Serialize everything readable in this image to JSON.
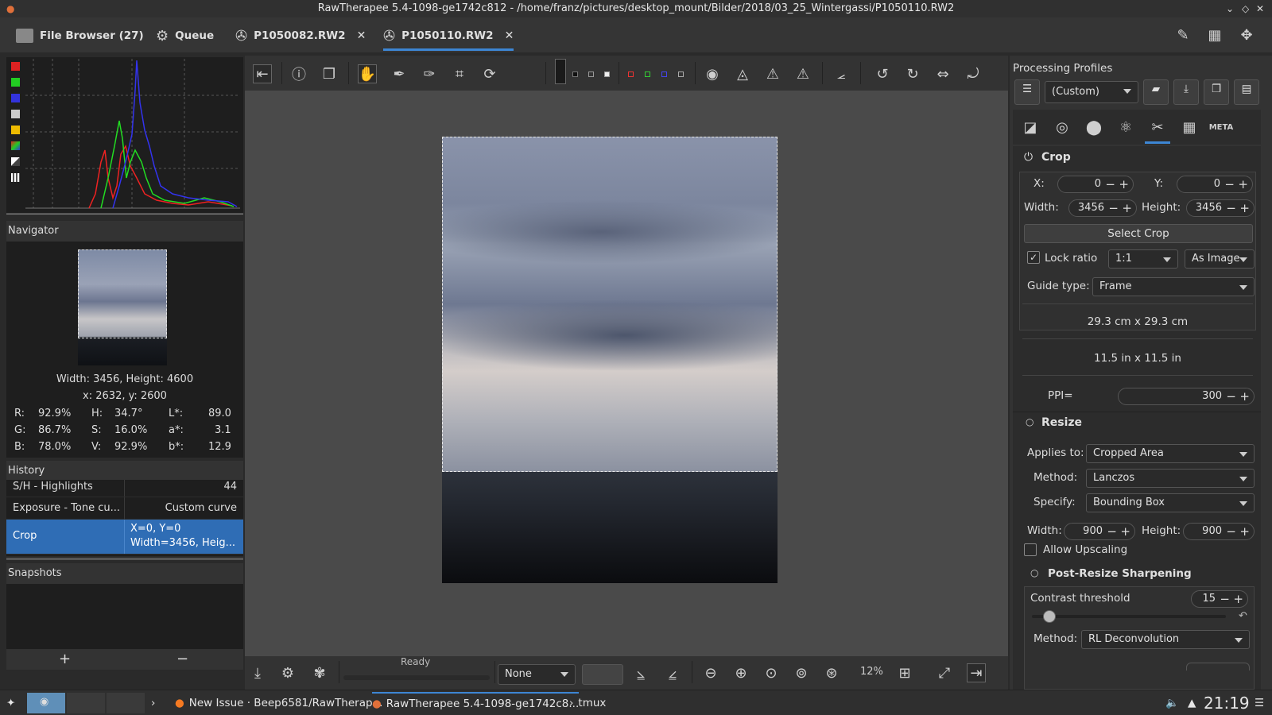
{
  "window": {
    "title": "RawTherapee 5.4-1098-ge1742c812 - /home/franz/pictures/desktop_mount/Bilder/2018/03_25_Wintergassi/P1050110.RW2"
  },
  "tabs": [
    {
      "label": "File Browser (27)",
      "icon": "folder-icon"
    },
    {
      "label": "Queue",
      "icon": "gears-icon"
    },
    {
      "label": "P1050082.RW2",
      "icon": "aperture-icon",
      "closable": true
    },
    {
      "label": "P1050110.RW2",
      "icon": "aperture-icon",
      "closable": true,
      "active": true
    }
  ],
  "navigator": {
    "title": "Navigator",
    "size": "Width: 3456, Height: 4600",
    "coords": "x: 2632, y: 2600",
    "rows": [
      {
        "c1": "R:",
        "v1": "92.9%",
        "c2": "H:",
        "v2": "34.7°",
        "c3": "L*:",
        "v3": "89.0"
      },
      {
        "c1": "G:",
        "v1": "86.7%",
        "c2": "S:",
        "v2": "16.0%",
        "c3": "a*:",
        "v3": "3.1"
      },
      {
        "c1": "B:",
        "v1": "78.0%",
        "c2": "V:",
        "v2": "92.9%",
        "c3": "b*:",
        "v3": "12.9"
      }
    ]
  },
  "history": {
    "title": "History",
    "items": [
      {
        "name": "S/H - Highlights",
        "value": "44"
      },
      {
        "name": "Exposure - Tone cu...",
        "value": "Custom curve"
      },
      {
        "name": "Crop",
        "value": "X=0, Y=0",
        "value2": "Width=3456, Heig...",
        "selected": true
      }
    ]
  },
  "snapshots": {
    "title": "Snapshots",
    "add": "+",
    "remove": "−"
  },
  "bottom": {
    "status": "Ready",
    "combo": "None",
    "zoom": "12%"
  },
  "processing": {
    "title": "Processing Profiles",
    "profile": "(Custom)"
  },
  "crop": {
    "title": "Crop",
    "x_label": "X:",
    "x": "0",
    "y_label": "Y:",
    "y": "0",
    "w_label": "Width:",
    "w": "3456",
    "h_label": "Height:",
    "h": "3456",
    "select_btn": "Select Crop",
    "lock_label": "Lock ratio",
    "ratio": "1:1",
    "orientation": "As Image",
    "guide_label": "Guide type:",
    "guide": "Frame",
    "size_cm": "29.3 cm x 29.3 cm",
    "size_in": "11.5 in x 11.5 in",
    "ppi_label": "PPI=",
    "ppi": "300"
  },
  "resize": {
    "title": "Resize",
    "applies_label": "Applies to:",
    "applies": "Cropped Area",
    "method_label": "Method:",
    "method": "Lanczos",
    "specify_label": "Specify:",
    "specify": "Bounding Box",
    "w_label": "Width:",
    "w": "900",
    "h_label": "Height:",
    "h": "900",
    "upscale_label": "Allow Upscaling"
  },
  "sharpen": {
    "title": "Post-Resize Sharpening",
    "threshold_label": "Contrast threshold",
    "threshold": "15",
    "method_label": "Method:",
    "method": "RL Deconvolution"
  },
  "taskbar": {
    "items": [
      "New Issue · Beep6581/RawTherap...",
      "RawTherapee 5.4-1098-ge1742c8...",
      "tmux"
    ],
    "clock": "21:19"
  },
  "colors": {
    "accent": "#3d86d4",
    "selected": "#2f6db5"
  }
}
